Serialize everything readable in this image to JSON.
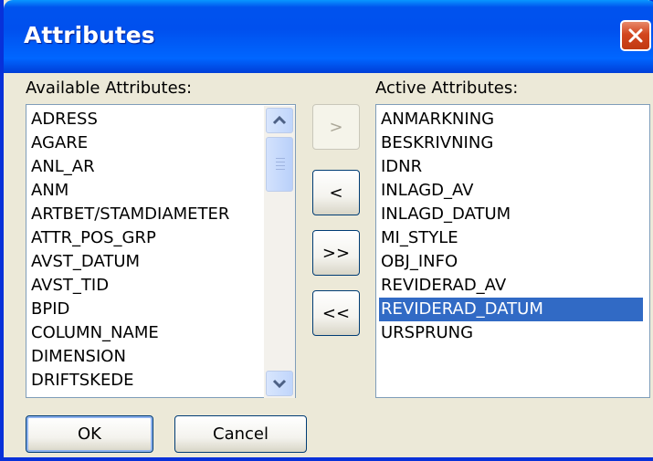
{
  "window": {
    "title": "Attributes"
  },
  "available": {
    "label": "Available Attributes:",
    "items": [
      "ADRESS",
      "AGARE",
      "ANL_AR",
      "ANM",
      "ARTBET/STAMDIAMETER",
      "ATTR_POS_GRP",
      "AVST_DATUM",
      "AVST_TID",
      "BPID",
      "COLUMN_NAME",
      "DIMENSION",
      "DRIFTSKEDE"
    ]
  },
  "active": {
    "label": "Active Attributes:",
    "items": [
      "ANMARKNING",
      "BESKRIVNING",
      "IDNR",
      "INLAGD_AV",
      "INLAGD_DATUM",
      "MI_STYLE",
      "OBJ_INFO",
      "REVIDERAD_AV",
      "REVIDERAD_DATUM",
      "URSPRUNG"
    ],
    "selected_index": 8
  },
  "transfer": {
    "add_label": ">",
    "remove_label": "<",
    "add_all_label": ">>",
    "remove_all_label": "<<"
  },
  "buttons": {
    "ok_label": "OK",
    "cancel_label": "Cancel"
  },
  "colors": {
    "titlebar": "#0054e3",
    "selection": "#316ac5",
    "close": "#d2461f"
  }
}
